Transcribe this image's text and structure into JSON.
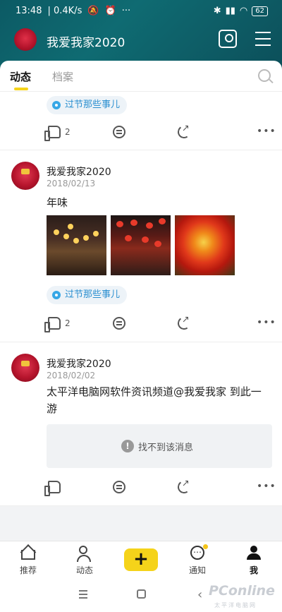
{
  "status_bar": {
    "time": "13:48",
    "speed": "0.4K/s",
    "battery": "62"
  },
  "header": {
    "title": "我爱我家2020"
  },
  "tabs": [
    {
      "label": "动态",
      "active": true
    },
    {
      "label": "档案",
      "active": false
    }
  ],
  "feed": {
    "partial_card": {
      "topic": "过节那些事儿",
      "likes": "2"
    },
    "posts": [
      {
        "author": "我爱我家2020",
        "date": "2018/02/13",
        "text": "年味",
        "photos": [
          "lantern-street-photo",
          "red-lantern-street-photo",
          "tulip-photo"
        ],
        "topic": "过节那些事儿",
        "likes": "2"
      },
      {
        "author": "我爱我家2020",
        "date": "2018/02/02",
        "text_line1": "太平洋电脑网软件资讯频道@我爱我家 到此一",
        "text_line2": "游",
        "notice": "找不到该消息",
        "likes": ""
      }
    ]
  },
  "bottom_nav": [
    {
      "label": "推荐"
    },
    {
      "label": "动态"
    },
    {
      "label": "+"
    },
    {
      "label": "通知"
    },
    {
      "label": "我"
    }
  ],
  "more_label": "•••",
  "watermark": {
    "main": "PConline",
    "sub": "太平洋电脑网"
  },
  "colors": {
    "accent": "#f5d31a",
    "header_bg": "#0f6b72",
    "topic_blue": "#2a8fd0"
  }
}
